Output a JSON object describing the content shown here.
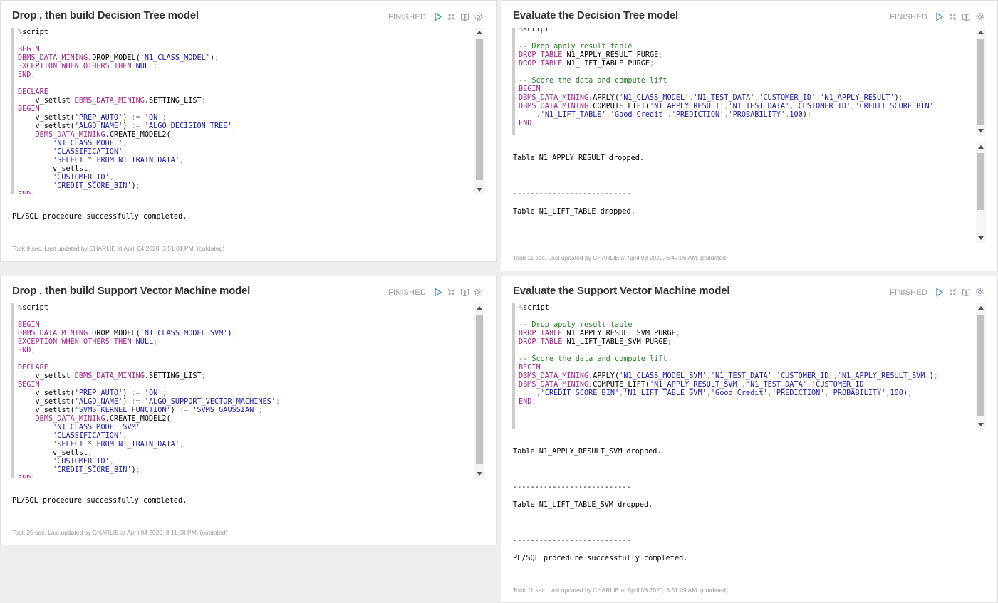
{
  "paragraphs": [
    {
      "id": "p1",
      "title": "Drop , then build Decision Tree model",
      "status": "FINISHED",
      "code_lines": [
        [
          [
            "p",
            "%"
          ],
          [
            "t",
            "script"
          ]
        ],
        [],
        [
          [
            "k",
            "BEGIN"
          ]
        ],
        [
          [
            "k",
            "DBMS_DATA_MINING"
          ],
          [
            "t",
            ".DROP_MODEL("
          ],
          [
            "s",
            "'N1_CLASS_MODEL'"
          ],
          [
            "t",
            ")"
          ],
          [
            "p",
            ";"
          ]
        ],
        [
          [
            "k",
            "EXCEPTION WHEN OTHERS THEN "
          ],
          [
            "n",
            "NULL"
          ],
          [
            "p",
            ";"
          ]
        ],
        [
          [
            "k",
            "END"
          ],
          [
            "p",
            ";"
          ]
        ],
        [],
        [
          [
            "k",
            "DECLARE"
          ]
        ],
        [
          [
            "t",
            "    v_setlst "
          ],
          [
            "k",
            "DBMS_DATA_MINING"
          ],
          [
            "t",
            ".SETTING_LIST"
          ],
          [
            "p",
            ";"
          ]
        ],
        [
          [
            "k",
            "BEGIN"
          ]
        ],
        [
          [
            "t",
            "    v_setlst("
          ],
          [
            "s",
            "'PREP_AUTO'"
          ],
          [
            "t",
            ") "
          ],
          [
            "p",
            ":="
          ],
          [
            "t",
            " "
          ],
          [
            "s",
            "'ON'"
          ],
          [
            "p",
            ";"
          ]
        ],
        [
          [
            "t",
            "    v_setlst("
          ],
          [
            "s",
            "'ALGO_NAME'"
          ],
          [
            "t",
            ") "
          ],
          [
            "p",
            ":="
          ],
          [
            "t",
            " "
          ],
          [
            "s",
            "'ALGO_DECISION_TREE'"
          ],
          [
            "p",
            ";"
          ]
        ],
        [
          [
            "t",
            "    "
          ],
          [
            "k",
            "DBMS_DATA_MINING"
          ],
          [
            "t",
            ".CREATE_MODEL2("
          ]
        ],
        [
          [
            "t",
            "        "
          ],
          [
            "s",
            "'N1_CLASS_MODEL'"
          ],
          [
            "p",
            ","
          ]
        ],
        [
          [
            "t",
            "        "
          ],
          [
            "s",
            "'CLASSIFICATION'"
          ],
          [
            "p",
            ","
          ]
        ],
        [
          [
            "t",
            "        "
          ],
          [
            "s",
            "'SELECT * FROM N1_TRAIN_DATA'"
          ],
          [
            "p",
            ","
          ]
        ],
        [
          [
            "t",
            "        v_setlst"
          ],
          [
            "p",
            ","
          ]
        ],
        [
          [
            "t",
            "        "
          ],
          [
            "s",
            "'CUSTOMER_ID'"
          ],
          [
            "p",
            ","
          ]
        ],
        [
          [
            "t",
            "        "
          ],
          [
            "s",
            "'CREDIT_SCORE_BIN'"
          ],
          [
            "t",
            ")"
          ],
          [
            "p",
            ";"
          ]
        ],
        [
          [
            "k",
            "END"
          ],
          [
            "p",
            ";"
          ]
        ]
      ],
      "output_lines": [
        "PL/SQL procedure successfully completed."
      ],
      "footer": "Took 9 sec. Last updated by CHARLIE at April 04 2020, 3:51:01 PM. (outdated)"
    },
    {
      "id": "p2",
      "title": "Evaluate the Decision Tree model",
      "status": "FINISHED",
      "code_lines": [
        [
          [
            "p",
            "%"
          ],
          [
            "t",
            "script"
          ]
        ],
        [],
        [
          [
            "c",
            "-- Drop apply result table"
          ]
        ],
        [
          [
            "k",
            "DROP TABLE "
          ],
          [
            "t",
            "N1_APPLY_RESULT PURGE"
          ],
          [
            "p",
            ";"
          ]
        ],
        [
          [
            "k",
            "DROP TABLE "
          ],
          [
            "t",
            "N1_LIFT_TABLE PURGE"
          ],
          [
            "p",
            ";"
          ]
        ],
        [],
        [
          [
            "c",
            "-- Score the data and compute lift"
          ]
        ],
        [
          [
            "k",
            "BEGIN"
          ]
        ],
        [
          [
            "k",
            "DBMS_DATA_MINING"
          ],
          [
            "t",
            ".APPLY("
          ],
          [
            "s",
            "'N1_CLASS_MODEL'"
          ],
          [
            "p",
            ","
          ],
          [
            "s",
            "'N1_TEST_DATA'"
          ],
          [
            "p",
            ","
          ],
          [
            "s",
            "'CUSTOMER_ID'"
          ],
          [
            "p",
            ","
          ],
          [
            "s",
            "'N1_APPLY_RESULT'"
          ],
          [
            "t",
            ")"
          ],
          [
            "p",
            ";"
          ]
        ],
        [
          [
            "k",
            "DBMS_DATA_MINING"
          ],
          [
            "t",
            ".COMPUTE_LIFT("
          ],
          [
            "s",
            "'N1_APPLY_RESULT'"
          ],
          [
            "p",
            ","
          ],
          [
            "s",
            "'N1_TEST_DATA'"
          ],
          [
            "p",
            ","
          ],
          [
            "s",
            "'CUSTOMER_ID'"
          ],
          [
            "p",
            ","
          ],
          [
            "s",
            "'CREDIT_SCORE_BIN'"
          ]
        ],
        [
          [
            "t",
            "    "
          ],
          [
            "p",
            ","
          ],
          [
            "s",
            "'N1_LIFT_TABLE'"
          ],
          [
            "p",
            ","
          ],
          [
            "s",
            "'Good Credit'"
          ],
          [
            "p",
            ","
          ],
          [
            "s",
            "'PREDICTION'"
          ],
          [
            "p",
            ","
          ],
          [
            "s",
            "'PROBABILITY'"
          ],
          [
            "p",
            ","
          ],
          [
            "n",
            "100"
          ],
          [
            "t",
            ")"
          ],
          [
            "p",
            ";"
          ]
        ],
        [
          [
            "k",
            "END"
          ],
          [
            "p",
            ";"
          ]
        ]
      ],
      "output_lines": [
        "Table N1_APPLY_RESULT dropped.",
        "",
        "",
        "",
        "---------------------------",
        "",
        "Table N1_LIFT_TABLE dropped."
      ],
      "footer": "Took 11 sec. Last updated by CHARLIE at April 08 2020, 6:47:06 AM. (outdated)"
    },
    {
      "id": "p3",
      "title": "Drop , then build Support Vector Machine model",
      "status": "FINISHED",
      "code_lines": [
        [
          [
            "p",
            "%"
          ],
          [
            "t",
            "script"
          ]
        ],
        [],
        [
          [
            "k",
            "BEGIN"
          ]
        ],
        [
          [
            "k",
            "DBMS_DATA_MINING"
          ],
          [
            "t",
            ".DROP_MODEL("
          ],
          [
            "s",
            "'N1_CLASS_MODEL_SVM'"
          ],
          [
            "t",
            ")"
          ],
          [
            "p",
            ";"
          ]
        ],
        [
          [
            "k",
            "EXCEPTION WHEN OTHERS THEN "
          ],
          [
            "n",
            "NULL"
          ],
          [
            "p",
            ";"
          ]
        ],
        [
          [
            "k",
            "END"
          ],
          [
            "p",
            ";"
          ]
        ],
        [],
        [
          [
            "k",
            "DECLARE"
          ]
        ],
        [
          [
            "t",
            "    v_setlst "
          ],
          [
            "k",
            "DBMS_DATA_MINING"
          ],
          [
            "t",
            ".SETTING_LIST"
          ],
          [
            "p",
            ";"
          ]
        ],
        [
          [
            "k",
            "BEGIN"
          ]
        ],
        [
          [
            "t",
            "    v_setlst("
          ],
          [
            "s",
            "'PREP_AUTO'"
          ],
          [
            "t",
            ") "
          ],
          [
            "p",
            ":="
          ],
          [
            "t",
            " "
          ],
          [
            "s",
            "'ON'"
          ],
          [
            "p",
            ";"
          ]
        ],
        [
          [
            "t",
            "    v_setlst("
          ],
          [
            "s",
            "'ALGO_NAME'"
          ],
          [
            "t",
            ") "
          ],
          [
            "p",
            ":="
          ],
          [
            "t",
            " "
          ],
          [
            "s",
            "'ALGO_SUPPORT_VECTOR_MACHINES'"
          ],
          [
            "p",
            ";"
          ]
        ],
        [
          [
            "t",
            "    v_setlst("
          ],
          [
            "s",
            "'SVMS_KERNEL_FUNCTION'"
          ],
          [
            "t",
            ") "
          ],
          [
            "p",
            ":="
          ],
          [
            "t",
            " "
          ],
          [
            "s",
            "'SVMS_GAUSSIAN'"
          ],
          [
            "p",
            ";"
          ]
        ],
        [
          [
            "t",
            "    "
          ],
          [
            "k",
            "DBMS_DATA_MINING"
          ],
          [
            "t",
            ".CREATE_MODEL2("
          ]
        ],
        [
          [
            "t",
            "        "
          ],
          [
            "s",
            "'N1_CLASS_MODEL_SVM'"
          ],
          [
            "p",
            ","
          ]
        ],
        [
          [
            "t",
            "        "
          ],
          [
            "s",
            "'CLASSIFICATION'"
          ],
          [
            "p",
            ","
          ]
        ],
        [
          [
            "t",
            "        "
          ],
          [
            "s",
            "'SELECT * FROM N1_TRAIN_DATA'"
          ],
          [
            "p",
            ","
          ]
        ],
        [
          [
            "t",
            "        v_setlst"
          ],
          [
            "p",
            ","
          ]
        ],
        [
          [
            "t",
            "        "
          ],
          [
            "s",
            "'CUSTOMER_ID'"
          ],
          [
            "p",
            ","
          ]
        ],
        [
          [
            "t",
            "        "
          ],
          [
            "s",
            "'CREDIT_SCORE_BIN'"
          ],
          [
            "t",
            ")"
          ],
          [
            "p",
            ";"
          ]
        ],
        [
          [
            "k",
            "END"
          ],
          [
            "p",
            ";"
          ]
        ]
      ],
      "output_lines": [
        "PL/SQL procedure successfully completed."
      ],
      "footer": "Took 25 sec. Last updated by CHARLIE at April 04 2020, 3:11:08 PM. (outdated)"
    },
    {
      "id": "p4",
      "title": "Evaluate the Support Vector Machine model",
      "status": "FINISHED",
      "code_lines": [
        [
          [
            "p",
            "%"
          ],
          [
            "t",
            "script"
          ]
        ],
        [],
        [
          [
            "c",
            "-- Drop apply result table"
          ]
        ],
        [
          [
            "k",
            "DROP TABLE "
          ],
          [
            "t",
            "N1_APPLY_RESULT_SVM PURGE"
          ],
          [
            "p",
            ";"
          ]
        ],
        [
          [
            "k",
            "DROP TABLE "
          ],
          [
            "t",
            "N1_LIFT_TABLE_SVM PURGE"
          ],
          [
            "p",
            ";"
          ]
        ],
        [],
        [
          [
            "c",
            "-- Score the data and compute lift"
          ]
        ],
        [
          [
            "k",
            "BEGIN"
          ]
        ],
        [
          [
            "k",
            "DBMS_DATA_MINING"
          ],
          [
            "t",
            ".APPLY("
          ],
          [
            "s",
            "'N1_CLASS_MODEL_SVM'"
          ],
          [
            "p",
            ","
          ],
          [
            "s",
            "'N1_TEST_DATA'"
          ],
          [
            "p",
            ","
          ],
          [
            "s",
            "'CUSTOMER_ID'"
          ],
          [
            "p",
            ","
          ],
          [
            "s",
            "'N1_APPLY_RESULT_SVM'"
          ],
          [
            "t",
            ")"
          ],
          [
            "p",
            ";"
          ]
        ],
        [
          [
            "k",
            "DBMS_DATA_MINING"
          ],
          [
            "t",
            ".COMPUTE_LIFT("
          ],
          [
            "s",
            "'N1_APPLY_RESULT_SVM'"
          ],
          [
            "p",
            ","
          ],
          [
            "s",
            "'N1_TEST_DATA'"
          ],
          [
            "p",
            ","
          ],
          [
            "s",
            "'CUSTOMER_ID'"
          ]
        ],
        [
          [
            "t",
            "    "
          ],
          [
            "p",
            ","
          ],
          [
            "s",
            "'CREDIT_SCORE_BIN'"
          ],
          [
            "p",
            ","
          ],
          [
            "s",
            "'N1_LIFT_TABLE_SVM'"
          ],
          [
            "p",
            ","
          ],
          [
            "s",
            "'Good Credit'"
          ],
          [
            "p",
            ","
          ],
          [
            "s",
            "'PREDICTION'"
          ],
          [
            "p",
            ","
          ],
          [
            "s",
            "'PROBABILITY'"
          ],
          [
            "p",
            ","
          ],
          [
            "n",
            "100"
          ],
          [
            "t",
            ")"
          ],
          [
            "p",
            ";"
          ]
        ],
        [
          [
            "k",
            "END"
          ],
          [
            "p",
            ";"
          ]
        ]
      ],
      "output_lines": [
        "Table N1_APPLY_RESULT_SVM dropped.",
        "",
        "",
        "",
        "---------------------------",
        "",
        "Table N1_LIFT_TABLE_SVM dropped.",
        "",
        "",
        "",
        "---------------------------",
        "",
        "PL/SQL procedure successfully completed."
      ],
      "footer": "Took 11 sec. Last updated by CHARLIE at April 08 2020, 6:51:09 AM. (outdated)"
    }
  ],
  "icons": [
    "run-icon",
    "collapse-icon",
    "book-icon",
    "settings-icon"
  ],
  "colors": {
    "keyword": "#a0258f",
    "string": "#1a1aa6",
    "comment": "#237d23",
    "status": "#999999",
    "run": "#3c8dbc"
  }
}
